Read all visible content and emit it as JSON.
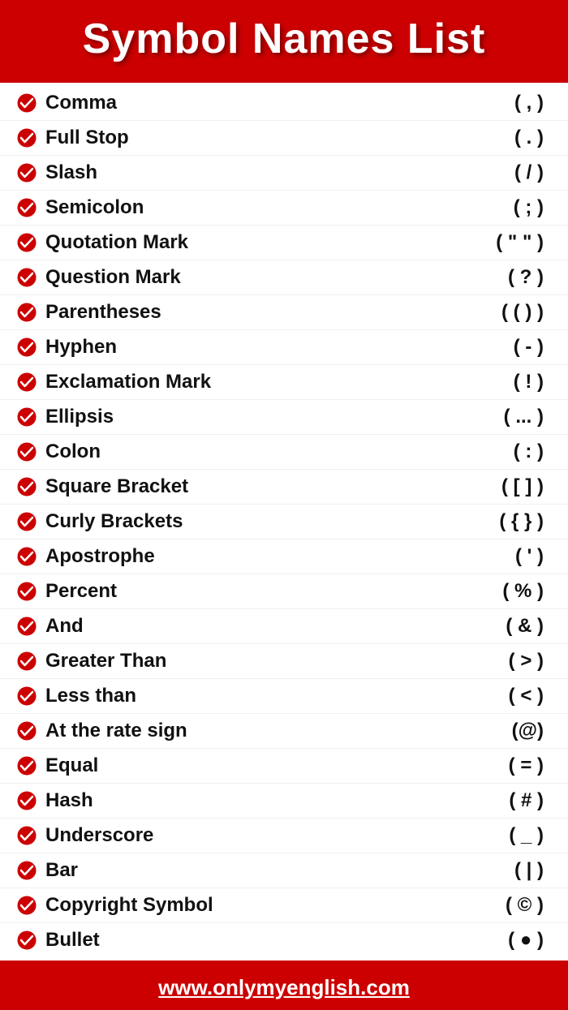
{
  "header": {
    "title": "Symbol Names List"
  },
  "items": [
    {
      "name": "Comma",
      "symbol": "( , )"
    },
    {
      "name": "Full Stop",
      "symbol": "( . )"
    },
    {
      "name": "Slash",
      "symbol": "( / )"
    },
    {
      "name": "Semicolon",
      "symbol": "( ; )"
    },
    {
      "name": "Quotation Mark",
      "symbol": "( \" \" )"
    },
    {
      "name": "Question Mark",
      "symbol": "( ? )"
    },
    {
      "name": "Parentheses",
      "symbol": "( ( ) )"
    },
    {
      "name": "Hyphen",
      "symbol": "( - )"
    },
    {
      "name": "Exclamation Mark",
      "symbol": "( ! )"
    },
    {
      "name": "Ellipsis",
      "symbol": "( ... )"
    },
    {
      "name": "Colon",
      "symbol": "( : )"
    },
    {
      "name": "Square Bracket",
      "symbol": "( [ ] )"
    },
    {
      "name": "Curly Brackets",
      "symbol": "( { } )"
    },
    {
      "name": "Apostrophe",
      "symbol": "( ' )"
    },
    {
      "name": "Percent",
      "symbol": "( % )"
    },
    {
      "name": "And",
      "symbol": "( & )"
    },
    {
      "name": "Greater Than",
      "symbol": "( > )"
    },
    {
      "name": "Less than",
      "symbol": "( < )"
    },
    {
      "name": "At the rate sign",
      "symbol": "(@)"
    },
    {
      "name": "Equal",
      "symbol": "( = )"
    },
    {
      "name": "Hash",
      "symbol": "( # )"
    },
    {
      "name": "Underscore",
      "symbol": "( _ )"
    },
    {
      "name": "Bar",
      "symbol": "( | )"
    },
    {
      "name": "Copyright Symbol",
      "symbol": "( © )"
    },
    {
      "name": "Bullet",
      "symbol": "( ● )"
    }
  ],
  "footer": {
    "url": "www.onlymyenglish.com"
  }
}
